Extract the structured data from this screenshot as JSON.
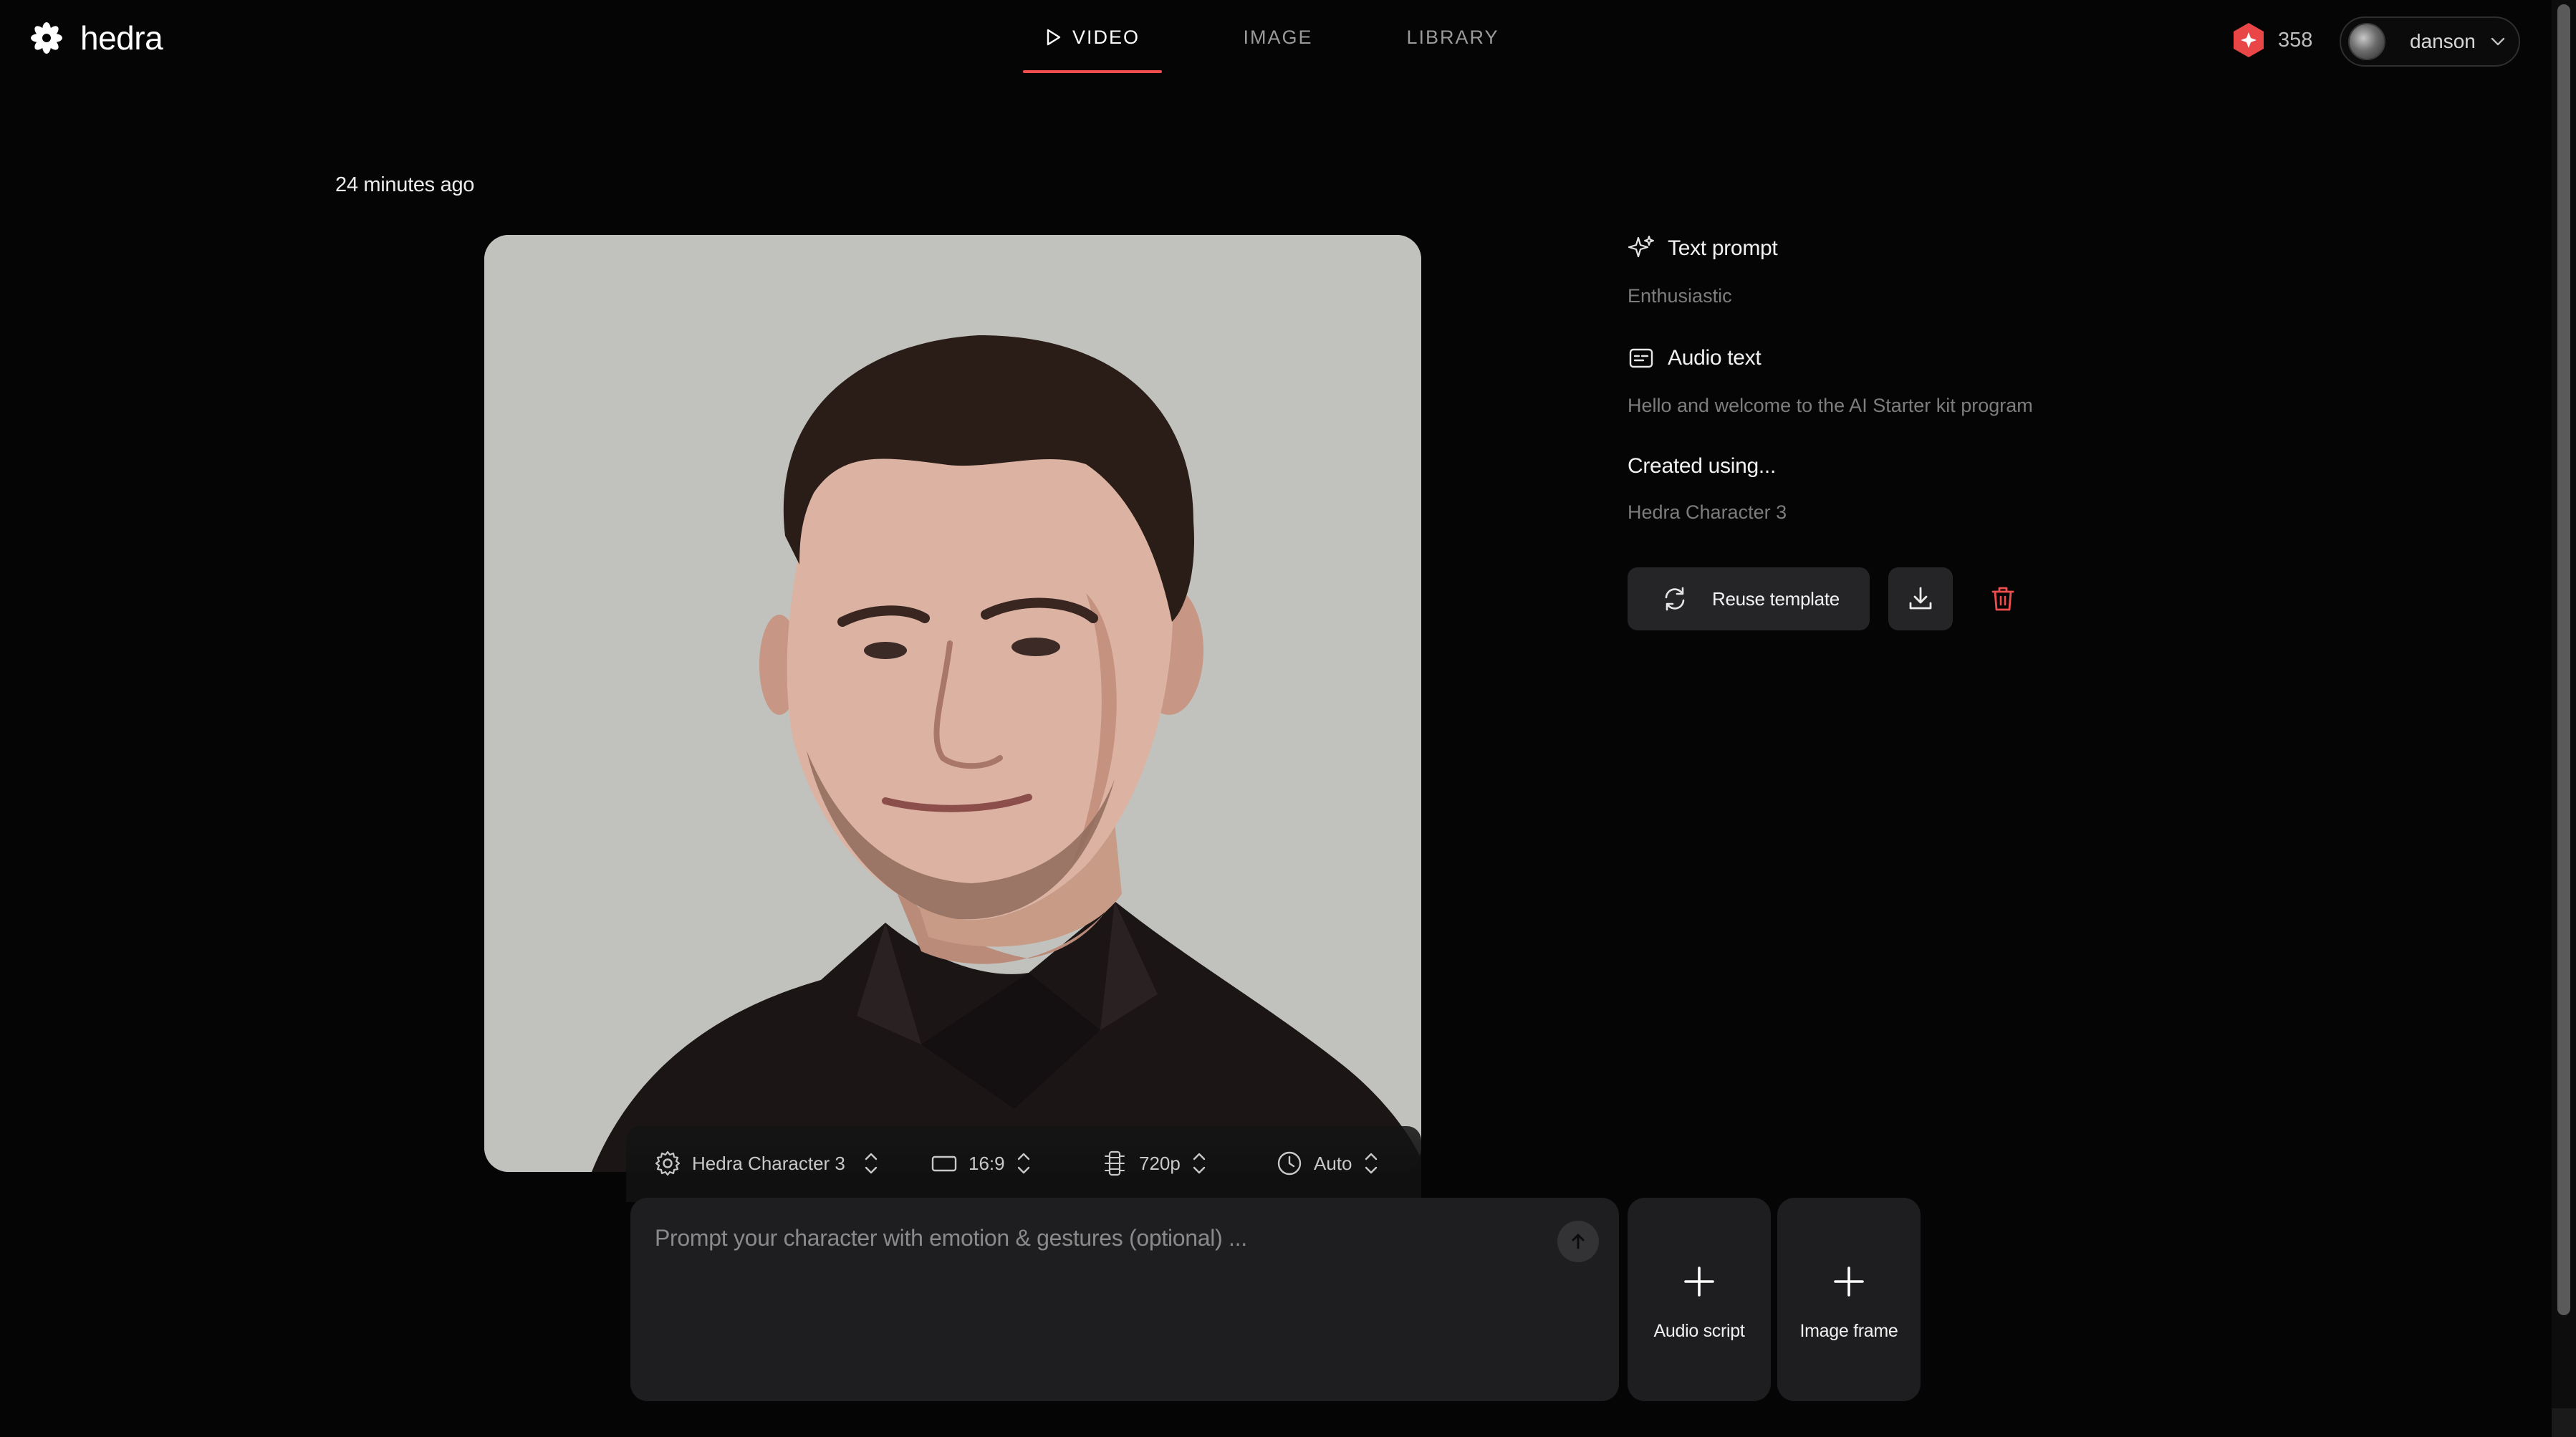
{
  "brand": {
    "name": "hedra",
    "logo_icon": "flower-logo-icon"
  },
  "nav": {
    "tabs": [
      {
        "label": "VIDEO",
        "icon": "play-icon",
        "active": true
      },
      {
        "label": "IMAGE",
        "active": false
      },
      {
        "label": "LIBRARY",
        "active": false
      }
    ]
  },
  "account": {
    "credits": "358",
    "credits_icon": "credits-badge-icon",
    "username": "danson"
  },
  "generation": {
    "timestamp": "24 minutes ago"
  },
  "details": {
    "text_prompt_label": "Text prompt",
    "text_prompt_value": "Enthusiastic",
    "audio_text_label": "Audio text",
    "audio_text_value": "Hello and welcome to the AI Starter kit program",
    "created_using_label": "Created using...",
    "created_using_value": "Hedra Character 3"
  },
  "actions": {
    "reuse_label": "Reuse template"
  },
  "settings": {
    "model": "Hedra Character 3",
    "aspect_ratio": "16:9",
    "resolution": "720p",
    "duration": "Auto"
  },
  "composer": {
    "placeholder": "Prompt your character with emotion & gestures (optional) ...",
    "audio_tile_label": "Audio script",
    "image_tile_label": "Image frame"
  },
  "colors": {
    "background": "#050505",
    "accent": "#f04e4e",
    "panel": "#1e1e20"
  }
}
